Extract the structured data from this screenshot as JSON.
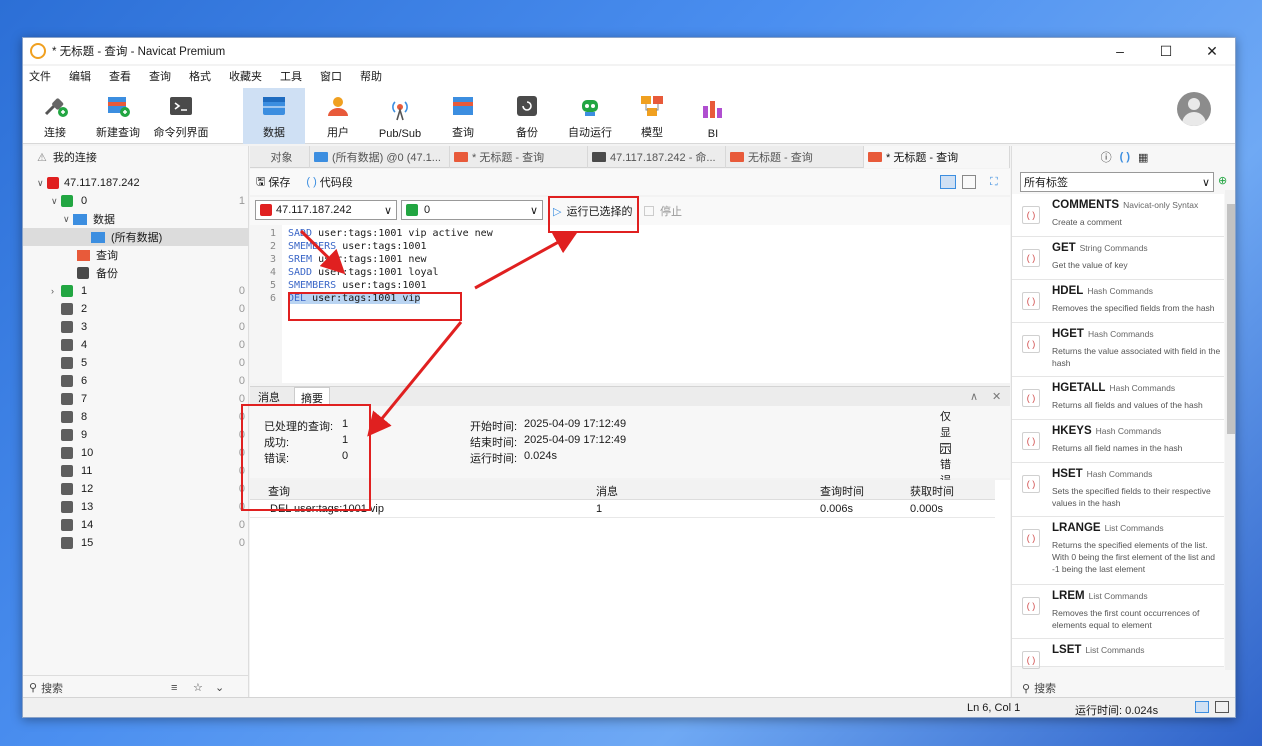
{
  "window": {
    "title": "* 无标题 - 查询 - Navicat Premium"
  },
  "menu": [
    "文件",
    "编辑",
    "查看",
    "查询",
    "格式",
    "收藏夹",
    "工具",
    "窗口",
    "帮助"
  ],
  "toolbar": {
    "left_buttons": [
      "连接",
      "新建查询",
      "命令列界面"
    ],
    "main_buttons": [
      "数据",
      "用户",
      "Pub/Sub",
      "查询",
      "备份",
      "自动运行",
      "模型",
      "BI"
    ]
  },
  "left_panel": {
    "header": "我的连接",
    "connection": "47.117.187.242",
    "db0": {
      "name": "0",
      "count": "1"
    },
    "data_node": "数据",
    "all_data": "(所有数据)",
    "query_node": "查询",
    "backup_node": "备份",
    "databases": [
      {
        "name": "1",
        "count": "0"
      },
      {
        "name": "2",
        "count": "0"
      },
      {
        "name": "3",
        "count": "0"
      },
      {
        "name": "4",
        "count": "0"
      },
      {
        "name": "5",
        "count": "0"
      },
      {
        "name": "6",
        "count": "0"
      },
      {
        "name": "7",
        "count": "0"
      },
      {
        "name": "8",
        "count": "0"
      },
      {
        "name": "9",
        "count": "0"
      },
      {
        "name": "10",
        "count": "0"
      },
      {
        "name": "11",
        "count": "0"
      },
      {
        "name": "12",
        "count": "0"
      },
      {
        "name": "13",
        "count": "0"
      },
      {
        "name": "14",
        "count": "0"
      },
      {
        "name": "15",
        "count": "0"
      }
    ],
    "search_label": "搜索"
  },
  "tabs": [
    "对象",
    "(所有数据) @0 (47.1...",
    "* 无标题 - 查询",
    "47.117.187.242 - 命...",
    "无标题 - 查询",
    "* 无标题 - 查询"
  ],
  "editor_toolbar": {
    "save": "保存",
    "snippet": "代码段"
  },
  "runbar": {
    "connection": "47.117.187.242",
    "database": "0",
    "run_selected": "运行已选择的",
    "stop": "停止"
  },
  "code_lines": [
    {
      "num": "1",
      "cmd": "SADD",
      "rest": " user:tags:1001 vip active new"
    },
    {
      "num": "2",
      "cmd": "SMEMBERS",
      "rest": " user:tags:1001"
    },
    {
      "num": "3",
      "cmd": "SREM",
      "rest": " user:tags:1001 new"
    },
    {
      "num": "4",
      "cmd": "SADD",
      "rest": " user:tags:1001 loyal"
    },
    {
      "num": "5",
      "cmd": "SMEMBERS",
      "rest": " user:tags:1001"
    },
    {
      "num": "6",
      "cmd": "DEL",
      "rest": " user:tags:1001 vip"
    }
  ],
  "results": {
    "tabs": [
      "消息",
      "摘要"
    ],
    "summary": {
      "processed_label": "已处理的查询:",
      "processed": "1",
      "success_label": "成功:",
      "success": "1",
      "error_label": "错误:",
      "error": "0",
      "start_label": "开始时间:",
      "start": "2025-04-09 17:12:49",
      "end_label": "结束时间:",
      "end": "2025-04-09 17:12:49",
      "runtime_label": "运行时间:",
      "runtime": "0.024s",
      "only_errors": "仅显示错误"
    },
    "columns": [
      "查询",
      "消息",
      "查询时间",
      "获取时间"
    ],
    "row": [
      "DEL user:tags:1001 vip",
      "1",
      "0.006s",
      "0.000s"
    ]
  },
  "right_panel": {
    "tag_filter": "所有标签",
    "search_label": "搜索",
    "snippets": [
      {
        "name": "COMMENTS",
        "category": "Navicat-only Syntax",
        "desc": "Create a comment"
      },
      {
        "name": "GET",
        "category": "String Commands",
        "desc": "Get the value of key"
      },
      {
        "name": "HDEL",
        "category": "Hash Commands",
        "desc": "Removes the specified fields from the hash"
      },
      {
        "name": "HGET",
        "category": "Hash Commands",
        "desc": "Returns the value associated with field in the hash"
      },
      {
        "name": "HGETALL",
        "category": "Hash Commands",
        "desc": "Returns all fields and values of the hash"
      },
      {
        "name": "HKEYS",
        "category": "Hash Commands",
        "desc": "Returns all field names in the hash"
      },
      {
        "name": "HSET",
        "category": "Hash Commands",
        "desc": "Sets the specified fields to their respective values in the hash"
      },
      {
        "name": "LRANGE",
        "category": "List Commands",
        "desc": "Returns the specified elements of the list. With 0 being the first element of the list and -1 being the last element"
      },
      {
        "name": "LREM",
        "category": "List Commands",
        "desc": "Removes the first count occurrences of elements equal to element"
      },
      {
        "name": "LSET",
        "category": "List Commands",
        "desc": ""
      }
    ]
  },
  "status": {
    "position": "Ln 6, Col 1",
    "runtime": "运行时间: 0.024s"
  },
  "colors": {
    "accent": "#3c8ee0",
    "annotation": "#e02020",
    "db_active": "#22a642"
  }
}
